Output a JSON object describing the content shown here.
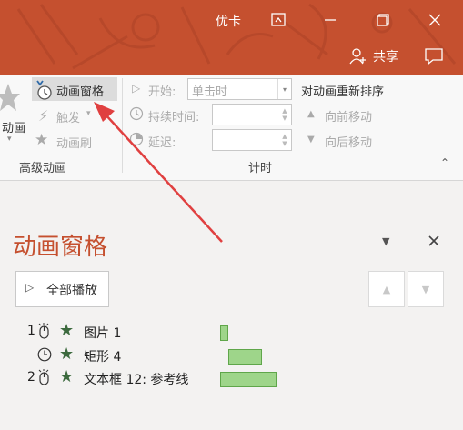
{
  "titlebar": {
    "title": "优卡",
    "share_label": "共享"
  },
  "ribbon": {
    "advanced": {
      "animation_label": "动画",
      "pane_button": "动画窗格",
      "trigger_button": "触发",
      "painter_button": "动画刷",
      "group_label": "高级动画"
    },
    "timing": {
      "start_label": "开始:",
      "start_value": "单击时",
      "duration_label": "持续时间:",
      "delay_label": "延迟:",
      "group_label": "计时"
    },
    "reorder": {
      "title": "对动画重新排序",
      "move_earlier": "向前移动",
      "move_later": "向后移动"
    }
  },
  "pane": {
    "title": "动画窗格",
    "play_all": "全部播放",
    "items": [
      {
        "number": "1",
        "trigger": "click",
        "name": "图片 1",
        "bar_start": 0,
        "bar_length": 0.15
      },
      {
        "number": "",
        "trigger": "after",
        "name": "矩形 4",
        "bar_start": 0.15,
        "bar_length": 0.6
      },
      {
        "number": "2",
        "trigger": "click",
        "name": "文本框 12: 参考线",
        "bar_start": 0,
        "bar_length": 1
      }
    ]
  },
  "colors": {
    "accent": "#c5502f",
    "bar": "#9ed58a",
    "arrow": "#e04040"
  }
}
